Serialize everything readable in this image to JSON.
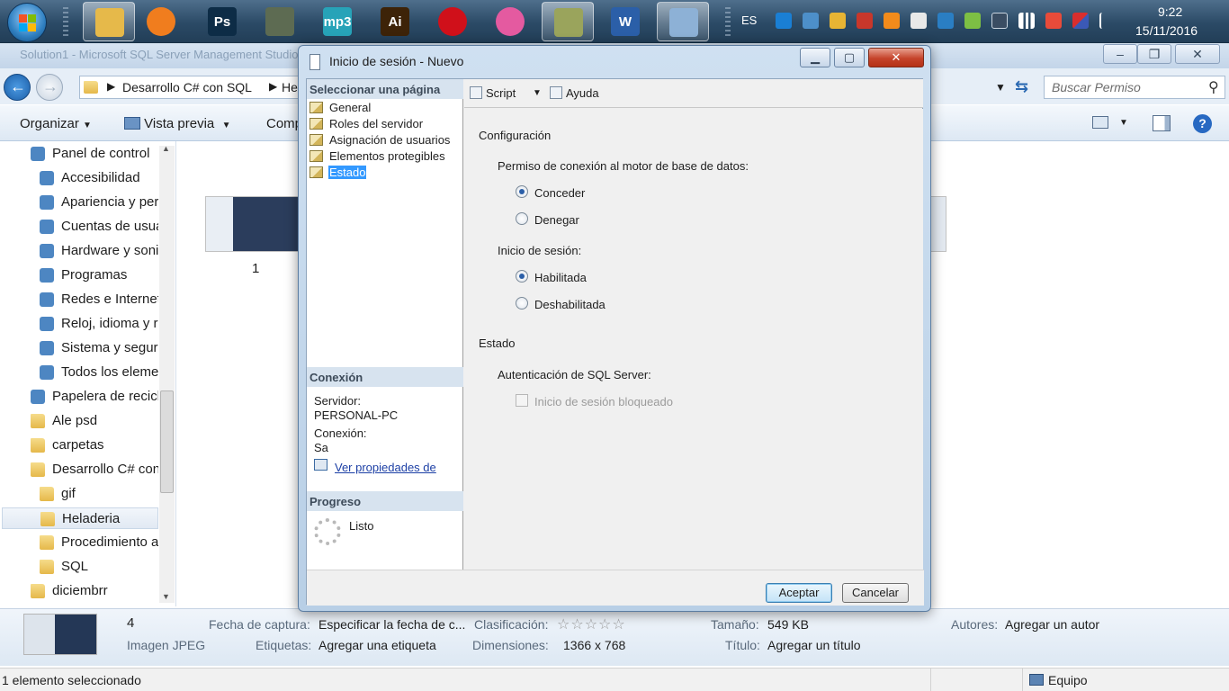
{
  "taskbar": {
    "apps": [
      {
        "name": "explorer",
        "icon": "folder-icon",
        "color": "#e6b94a",
        "active": true
      },
      {
        "name": "media-player",
        "icon": "play-icon",
        "color": "#f07d1e"
      },
      {
        "name": "photoshop",
        "icon": "photoshop-icon",
        "label": "Ps",
        "color": "#0d2c46"
      },
      {
        "name": "terminal",
        "icon": "terminal-icon",
        "color": "#5d6b52"
      },
      {
        "name": "mp3",
        "icon": "mp3-icon",
        "label": "mp3",
        "color": "#27a3b8"
      },
      {
        "name": "illustrator",
        "icon": "illustrator-icon",
        "label": "Ai",
        "color": "#3d2308"
      },
      {
        "name": "opera",
        "icon": "opera-icon",
        "color": "#d0101a"
      },
      {
        "name": "itunes",
        "icon": "itunes-icon",
        "color": "#e45aa0"
      },
      {
        "name": "sql-tools",
        "icon": "tools-icon",
        "color": "#9aa45c",
        "active": true
      },
      {
        "name": "word",
        "icon": "word-icon",
        "label": "W",
        "color": "#2b5fa8"
      },
      {
        "name": "paint",
        "icon": "paint-icon",
        "color": "#8db1d6",
        "active": true
      }
    ],
    "language": "ES",
    "time": "9:22",
    "date": "15/11/2016"
  },
  "explorer": {
    "title": "Solution1 - Microsoft SQL Server Management Studio",
    "address": [
      "Desarrollo C# con SQL",
      "He"
    ],
    "search_placeholder": "Buscar Permiso",
    "toolbar": {
      "organize": "Organizar",
      "preview": "Vista previa",
      "share": "Comp"
    },
    "nav": [
      {
        "label": "Panel de control",
        "icon": "control-panel-icon",
        "indent": 0
      },
      {
        "label": "Accesibilidad",
        "icon": "accessibility-icon",
        "indent": 1
      },
      {
        "label": "Apariencia y per",
        "icon": "appearance-icon",
        "indent": 1
      },
      {
        "label": "Cuentas de usua",
        "icon": "user-accounts-icon",
        "indent": 1
      },
      {
        "label": "Hardware y soni",
        "icon": "hardware-icon",
        "indent": 1
      },
      {
        "label": "Programas",
        "icon": "programs-icon",
        "indent": 1
      },
      {
        "label": "Redes e Internet",
        "icon": "network-icon",
        "indent": 1
      },
      {
        "label": "Reloj, idioma y r",
        "icon": "clock-icon",
        "indent": 1
      },
      {
        "label": "Sistema y seguri",
        "icon": "security-icon",
        "indent": 1
      },
      {
        "label": "Todos los eleme",
        "icon": "control-panel-icon",
        "indent": 1
      },
      {
        "label": "Papelera de recicl",
        "icon": "recycle-bin-icon",
        "indent": 0
      },
      {
        "label": "Ale psd",
        "icon": "folder-icon",
        "indent": 0
      },
      {
        "label": "carpetas",
        "icon": "folder-icon",
        "indent": 0
      },
      {
        "label": "Desarrollo C# con",
        "icon": "folder-icon",
        "indent": 0
      },
      {
        "label": "gif",
        "icon": "folder-icon",
        "indent": 1
      },
      {
        "label": "Heladeria",
        "icon": "folder-icon",
        "indent": 1,
        "selected": true
      },
      {
        "label": "Procedimiento a",
        "icon": "folder-icon",
        "indent": 1
      },
      {
        "label": "SQL",
        "icon": "folder-icon",
        "indent": 1
      },
      {
        "label": "diciembrr",
        "icon": "folder-icon",
        "indent": 0
      }
    ],
    "thumbnail_label": "1",
    "details": {
      "number": "4",
      "type": "Imagen JPEG",
      "capture_date_key": "Fecha de captura:",
      "capture_date_val": "Especificar la fecha de c...",
      "tags_key": "Etiquetas:",
      "tags_val": "Agregar una etiqueta",
      "rating_key": "Clasificación:",
      "rating_stars": "☆☆☆☆☆",
      "dimensions_key": "Dimensiones:",
      "dimensions_val": "1366 x 768",
      "size_key": "Tamaño:",
      "size_val": "549 KB",
      "title_key": "Título:",
      "title_val": "Agregar un título",
      "authors_key": "Autores:",
      "authors_val": "Agregar un autor"
    },
    "status": {
      "selected": "1 elemento seleccionado",
      "computer": "Equipo"
    }
  },
  "dialog": {
    "title": "Inicio de sesión - Nuevo",
    "select_page_header": "Seleccionar una página",
    "pages": [
      "General",
      "Roles del servidor",
      "Asignación de usuarios",
      "Elementos protegibles",
      "Estado"
    ],
    "selected_page": 4,
    "script_label": "Script",
    "help_label": "Ayuda",
    "connection_header": "Conexión",
    "server_key": "Servidor:",
    "server_val": "PERSONAL-PC",
    "connection_key": "Conexión:",
    "connection_val": "Sa",
    "view_props_link": "Ver propiedades de",
    "progress_header": "Progreso",
    "progress_status": "Listo",
    "config_header": "Configuración",
    "permission_label": "Permiso de conexión al motor de base de datos:",
    "grant_label": "Conceder",
    "deny_label": "Denegar",
    "grant_selected": true,
    "login_label": "Inicio de sesión:",
    "enabled_label": "Habilitada",
    "disabled_label": "Deshabilitada",
    "enabled_selected": true,
    "state_header": "Estado",
    "auth_label": "Autenticación de SQL Server:",
    "locked_label": "Inicio de sesión bloqueado",
    "locked_checked": false,
    "ok_label": "Aceptar",
    "cancel_label": "Cancelar"
  }
}
